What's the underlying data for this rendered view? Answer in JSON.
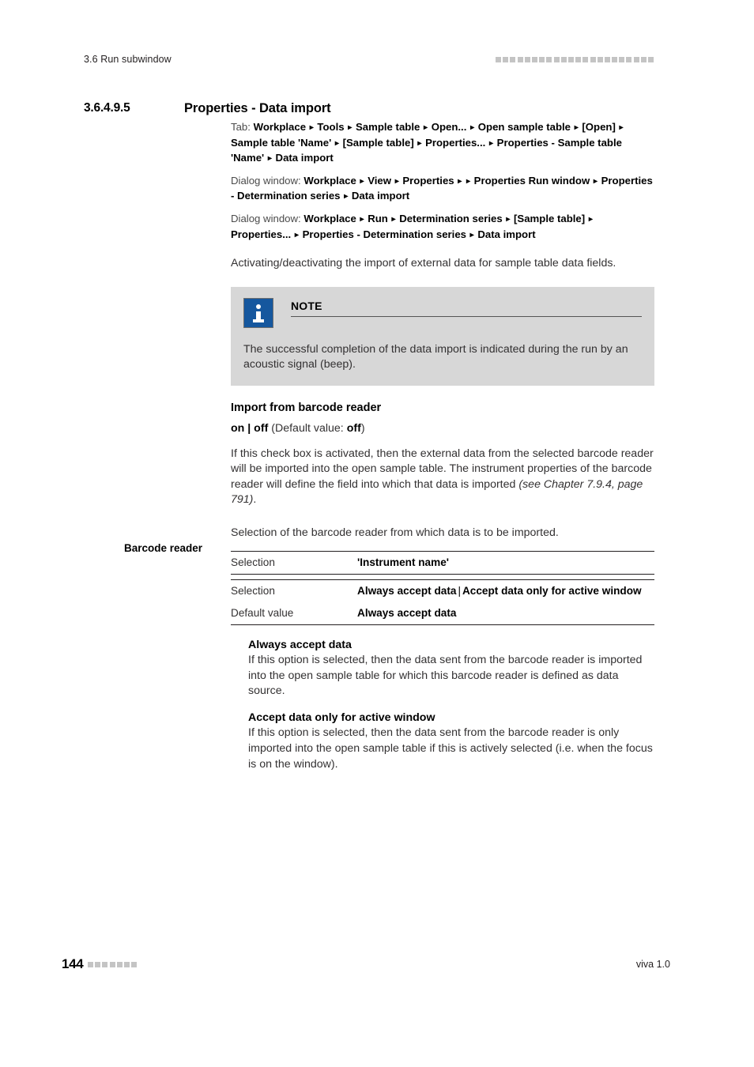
{
  "header": {
    "running_head": "3.6 Run subwindow",
    "square_count": 22,
    "square_color": "#c4c4c4"
  },
  "section": {
    "number": "3.6.4.9.5",
    "title": "Properties - Data import"
  },
  "breadcrumbs": [
    {
      "lead": "Tab:",
      "path": "Workplace ▸ Tools ▸ Sample table ▸ Open... ▸ Open sample table ▸ [Open] ▸ Sample table 'Name' ▸ [Sample table] ▸ Properties... ▸ Properties - Sample table 'Name' ▸ Data import"
    },
    {
      "lead": "Dialog window:",
      "path": "Workplace ▸ View ▸ Properties ▸  ▸ Properties Run window ▸ Properties - Determination series ▸ Data import"
    },
    {
      "lead": "Dialog window:",
      "path": "Workplace ▸ Run ▸ Determination series ▸ [Sample table] ▸ Properties... ▸ Properties - Determination series ▸ Data import"
    }
  ],
  "intro_paragraph": "Activating/deactivating the import of external data for sample table data fields.",
  "note": {
    "icon": "info-icon",
    "title": "NOTE",
    "body": "The successful completion of the data import is indicated during the run by an acoustic signal (beep).",
    "background": "#d7d7d7",
    "icon_color": "#15579e"
  },
  "import_section": {
    "heading": "Import from barcode reader",
    "value_bold_1": "on | off",
    "value_plain": " (Default value: ",
    "value_bold_2": "off",
    "value_tail": ")",
    "paragraph_plain": "If this check box is activated, then the external data from the selected barcode reader will be imported into the open sample table. The instrument properties of the barcode reader will define the field into which that data is imported ",
    "paragraph_italic": "(see Chapter 7.9.4, page 791)",
    "paragraph_tail": "."
  },
  "barcode_section": {
    "margin_label": "Barcode reader",
    "description": "Selection of the barcode reader from which data is to be imported.",
    "table_1": {
      "rows": [
        {
          "key": "Selection",
          "value": "'Instrument name'"
        }
      ]
    },
    "table_2": {
      "rows": [
        {
          "key": "Selection",
          "value_a": "Always accept data",
          "separator": "|",
          "value_b": "Accept data only for active window"
        },
        {
          "key": "Default value",
          "value_a": "Always accept data"
        }
      ]
    },
    "options": [
      {
        "title": "Always accept data",
        "body": "If this option is selected, then the data sent from the barcode reader is imported into the open sample table for which this barcode reader is defined as data source."
      },
      {
        "title": "Accept data only for active window",
        "body": "If this option is selected, then the data sent from the barcode reader is only imported into the open sample table if this is actively selected (i.e. when the focus is on the window)."
      }
    ]
  },
  "footer": {
    "page_number": "144",
    "square_count": 7,
    "product": "viva 1.0"
  }
}
